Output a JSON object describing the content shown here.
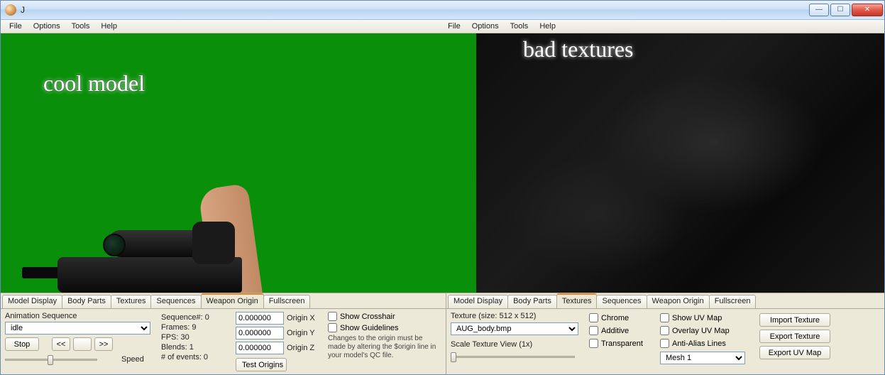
{
  "title": "J",
  "menu_left": [
    "File",
    "Options",
    "Tools",
    "Help"
  ],
  "menu_right": [
    "File",
    "Options",
    "Tools",
    "Help"
  ],
  "overlay_left": "cool model",
  "overlay_right": "bad textures",
  "tabs_left": [
    "Model Display",
    "Body Parts",
    "Textures",
    "Sequences",
    "Weapon Origin",
    "Fullscreen"
  ],
  "tabs_left_active": 4,
  "tabs_right": [
    "Model Display",
    "Body Parts",
    "Textures",
    "Sequences",
    "Weapon Origin",
    "Fullscreen"
  ],
  "tabs_right_active": 2,
  "left_panel": {
    "anim_seq_label": "Animation Sequence",
    "anim_seq_value": "idle",
    "stop_btn": "Stop",
    "prev_btn": "<<",
    "frame_btn": " ",
    "next_btn": ">>",
    "speed_label": "Speed",
    "seq_num_label": "Sequence#: 0",
    "frames_label": "Frames: 9",
    "fps_label": "FPS: 30",
    "blends_label": "Blends: 1",
    "events_label": "# of events: 0",
    "origin_x": "0.000000",
    "origin_y": "0.000000",
    "origin_z": "0.000000",
    "origin_x_label": "Origin X",
    "origin_y_label": "Origin Y",
    "origin_z_label": "Origin Z",
    "test_origins_btn": "Test Origins",
    "show_crosshair": "Show Crosshair",
    "show_guidelines": "Show Guidelines",
    "note": "Changes to the origin must be made by altering the $origin line in your model's QC file."
  },
  "right_panel": {
    "tex_size_label": "Texture (size: 512 x 512)",
    "tex_file": "AUG_body.bmp",
    "scale_label": "Scale Texture View (1x)",
    "chrome": "Chrome",
    "additive": "Additive",
    "transparent": "Transparent",
    "show_uv": "Show UV Map",
    "overlay_uv": "Overlay UV Map",
    "antialias": "Anti-Alias Lines",
    "mesh_value": "Mesh 1",
    "import_tex": "Import Texture",
    "export_tex": "Export Texture",
    "export_uv": "Export UV Map"
  }
}
